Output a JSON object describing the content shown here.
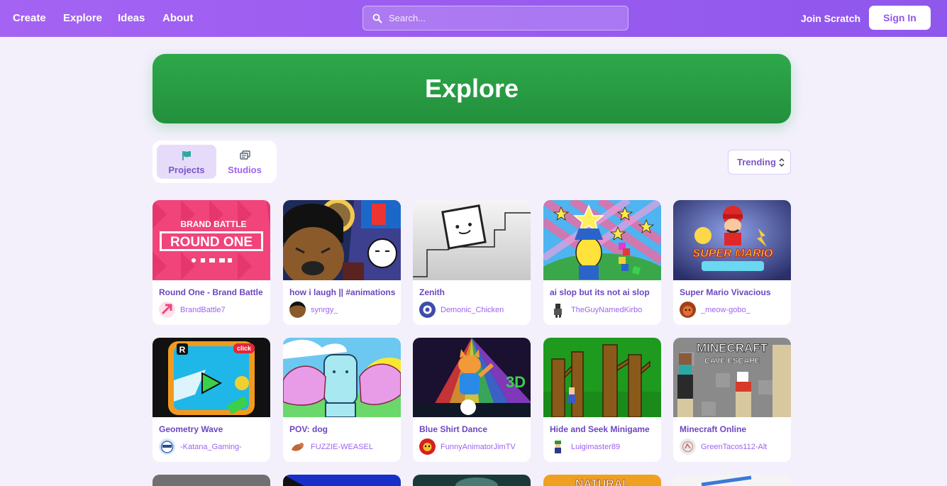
{
  "nav": {
    "links": [
      "Create",
      "Explore",
      "Ideas",
      "About"
    ],
    "search_placeholder": "Search...",
    "join_label": "Join Scratch",
    "signin_label": "Sign In"
  },
  "banner": {
    "title": "Explore"
  },
  "tabs": [
    {
      "label": "Projects",
      "icon": "flag-icon",
      "active": true
    },
    {
      "label": "Studios",
      "icon": "studios-icon",
      "active": false
    }
  ],
  "sort": {
    "selected": "Trending"
  },
  "projects": [
    {
      "title": "Round One - Brand Battle",
      "author": "BrandBattle7"
    },
    {
      "title": "how i laugh || #animations",
      "author": "synrgy_"
    },
    {
      "title": "Zenith",
      "author": "Demonic_Chicken"
    },
    {
      "title": "ai slop but its not ai slop",
      "author": "TheGuyNamedKirbo"
    },
    {
      "title": "Super Mario Vivacious",
      "author": "_meow-gobo_"
    },
    {
      "title": "Geometry Wave",
      "author": "-Katana_Gaming-"
    },
    {
      "title": "POV: dog",
      "author": "FUZZIE-WEASEL"
    },
    {
      "title": "Blue Shirt Dance",
      "author": "FunnyAnimatorJimTV"
    },
    {
      "title": "Hide and Seek Minigame",
      "author": "Luigimaster89"
    },
    {
      "title": "Minecraft Online",
      "author": "GreenTacos112-Alt"
    }
  ],
  "thumb_text": {
    "brand": "BRAND BATTLE",
    "round": "ROUND ONE",
    "click": "click",
    "three_d": "3D",
    "mc": "MINECRAFT",
    "cave": "CAVE ESCAPE",
    "super": "SUPER MARIO",
    "natural": "NATURAL"
  },
  "colors": {
    "nav": "#9a5cf0",
    "banner": "#2ea84b",
    "accent": "#6c46c2"
  }
}
